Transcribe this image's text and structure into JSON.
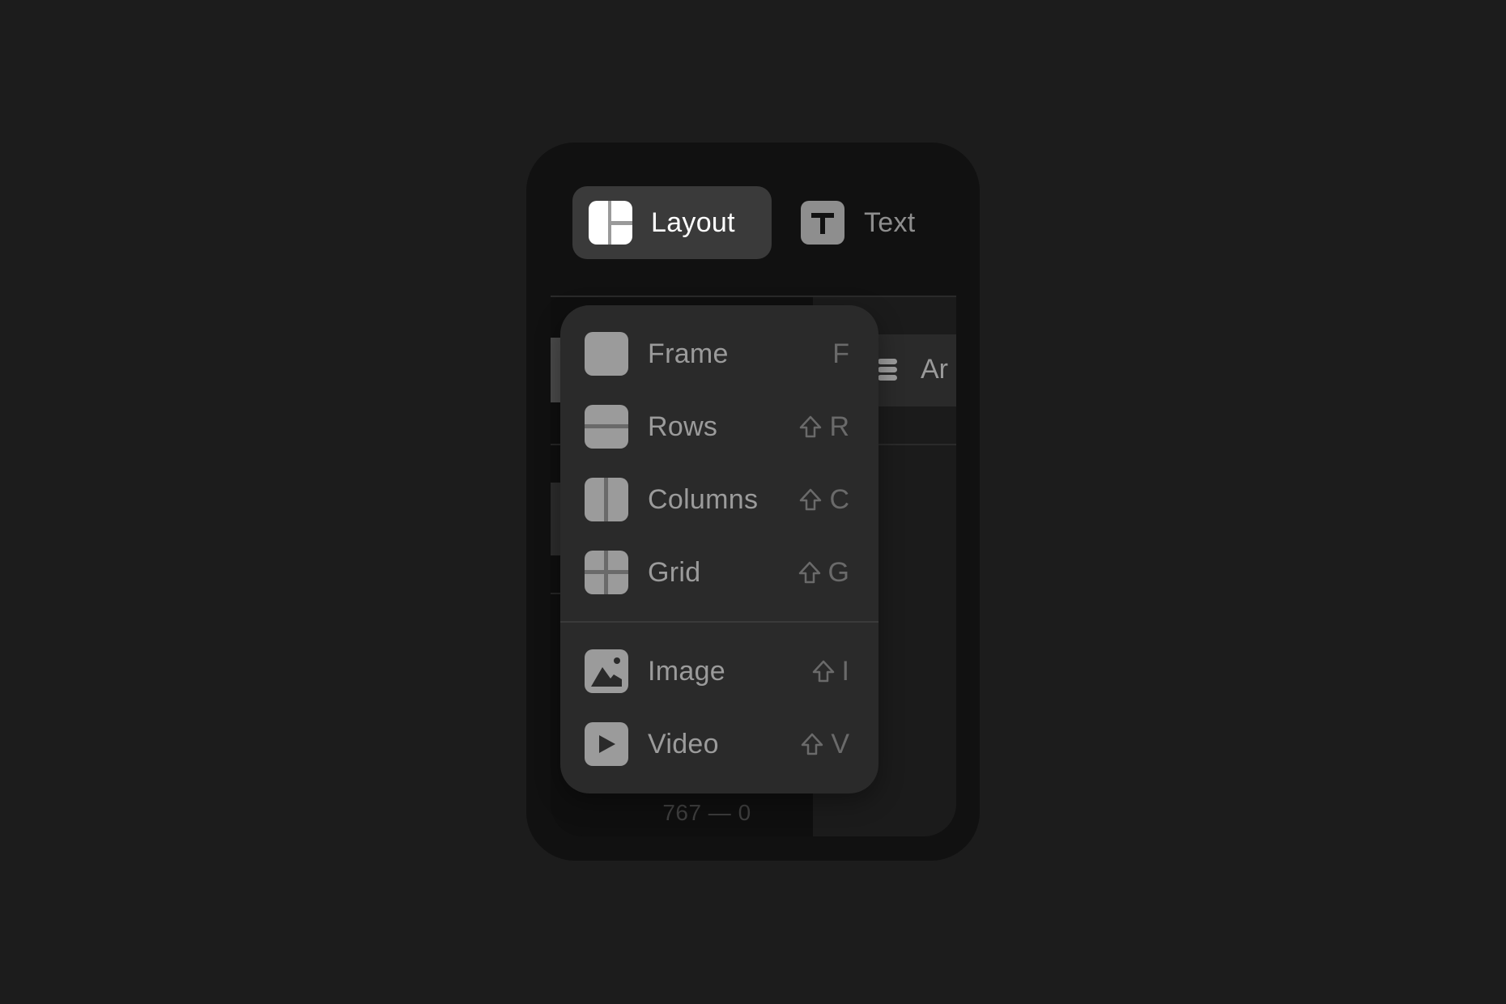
{
  "toolbar": {
    "layout": {
      "label": "Layout",
      "icon": "layout-icon",
      "active": true
    },
    "text": {
      "label": "Text",
      "icon": "text-icon",
      "active": false
    }
  },
  "background_panel": {
    "right_column_item": {
      "label": "Ar",
      "icon": "database-icon"
    },
    "footer_readout": "767 — 0"
  },
  "menu": {
    "items": [
      {
        "label": "Frame",
        "icon": "frame-icon",
        "modifier": "",
        "key": "F"
      },
      {
        "label": "Rows",
        "icon": "rows-icon",
        "modifier": "shift",
        "key": "R"
      },
      {
        "label": "Columns",
        "icon": "columns-icon",
        "modifier": "shift",
        "key": "C"
      },
      {
        "label": "Grid",
        "icon": "grid-icon",
        "modifier": "shift",
        "key": "G"
      },
      {
        "label": "Image",
        "icon": "image-icon",
        "modifier": "shift",
        "key": "I"
      },
      {
        "label": "Video",
        "icon": "video-icon",
        "modifier": "shift",
        "key": "V"
      }
    ]
  },
  "colors": {
    "page_bg": "#1c1c1c",
    "panel_bg": "#111111",
    "menu_bg": "#2a2a2a",
    "active_tab_bg": "#3a3a3a",
    "menu_text": "#9b9b9b",
    "shortcut_text": "#6a6a6a"
  }
}
